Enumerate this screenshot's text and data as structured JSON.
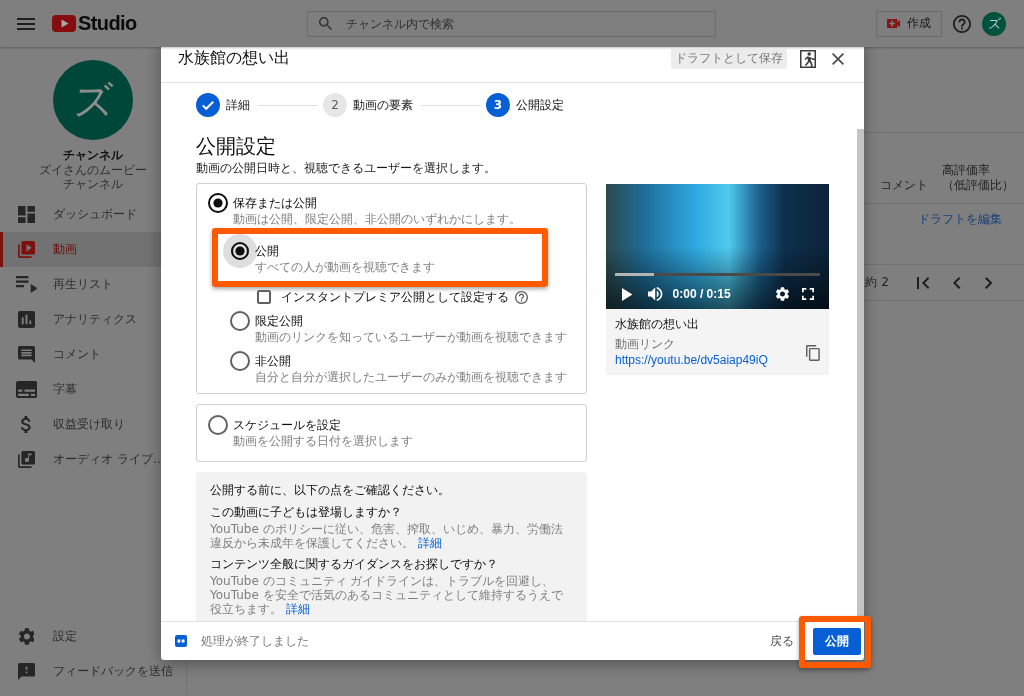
{
  "top_bar": {
    "logo": "Studio",
    "search": {
      "placeholder": "チャンネル内で検索"
    },
    "create_button": "作成",
    "avatar": "ズ"
  },
  "sidebar": {
    "channel": {
      "avatar": "ズ",
      "title": "チャンネル",
      "name": "ズイさんのムービーチャンネル"
    },
    "items": [
      {
        "label": "ダッシュボード",
        "selected": false
      },
      {
        "label": "動画",
        "selected": true
      },
      {
        "label": "再生リスト",
        "selected": false
      },
      {
        "label": "アナリティクス",
        "selected": false
      },
      {
        "label": "コメント",
        "selected": false
      },
      {
        "label": "字幕",
        "selected": false
      },
      {
        "label": "収益受け取り",
        "selected": false
      },
      {
        "label": "オーディオ ライブ…",
        "selected": false
      }
    ],
    "footer_items": [
      {
        "label": "設定",
        "selected": false
      },
      {
        "label": "フィードバックを送信",
        "selected": false
      }
    ]
  },
  "video_list": {
    "columns": [
      {
        "label": "コメント"
      },
      {
        "label": "高評価率（低評価比）"
      }
    ],
    "row_action": "ドラフトを編集",
    "pagination": "約 2"
  },
  "dialog": {
    "title": "水族館の想い出",
    "save_draft_button": "ドラフトとして保存",
    "steps": [
      {
        "label": "詳細",
        "completed": true,
        "selected": false
      },
      {
        "number": "2",
        "label": "動画の要素",
        "completed": false,
        "selected": false
      },
      {
        "number": "3",
        "label": "公開設定",
        "completed": false,
        "selected": true
      }
    ],
    "heading": "公開設定",
    "description": "動画の公開日時と、視聴できるユーザーを選択します。",
    "visibility": {
      "label": "保存または公開",
      "description": "動画は公開、限定公開、非公開のいずれかにします。",
      "selected": true,
      "options": [
        {
          "kind": "radio",
          "label": "公開",
          "description": "すべての人が動画を視聴できます",
          "selected": true,
          "focused": true,
          "highlighted": true
        },
        {
          "kind": "checkbox",
          "label": "インスタントプレミア公開として設定する",
          "checked": false
        },
        {
          "kind": "radio",
          "label": "限定公開",
          "description": "動画のリンクを知っているユーザーが動画を視聴できます",
          "selected": false,
          "focused": false,
          "highlighted": false
        },
        {
          "kind": "radio",
          "label": "非公開",
          "description": "自分と自分が選択したユーザーのみが動画を視聴できます",
          "selected": false,
          "focused": false,
          "highlighted": false
        }
      ]
    },
    "schedule": {
      "label": "スケジュールを設定",
      "description": "動画を公開する日付を選択します",
      "selected": false
    },
    "checklist": {
      "title": "公開する前に、以下の点をご確認ください。",
      "items": [
        {
          "question": "この動画に子どもは登場しますか？",
          "text": "YouTube のポリシーに従い、危害、搾取、いじめ、暴力、労働法違反から未成年を保護してください。",
          "link": "詳細"
        },
        {
          "question": "コンテンツ全般に関するガイダンスをお探しですか？",
          "text": "YouTube のコミュニティ ガイドラインは、トラブルを回避し、YouTube を安全で活気のあるコミュニティとして維持するうえで役立ちます。",
          "link": "詳細"
        }
      ]
    },
    "preview": {
      "level": 0.19,
      "time": "0:00 / 0:15",
      "title": "水族館の想い出",
      "link_label": "動画リンク",
      "url": "https://youtu.be/dv5aiap49iQ"
    },
    "footer": {
      "status": "処理が終了しました",
      "back_button": "戻る",
      "publish_button": {
        "label": "公開",
        "highlighted": true
      }
    }
  }
}
